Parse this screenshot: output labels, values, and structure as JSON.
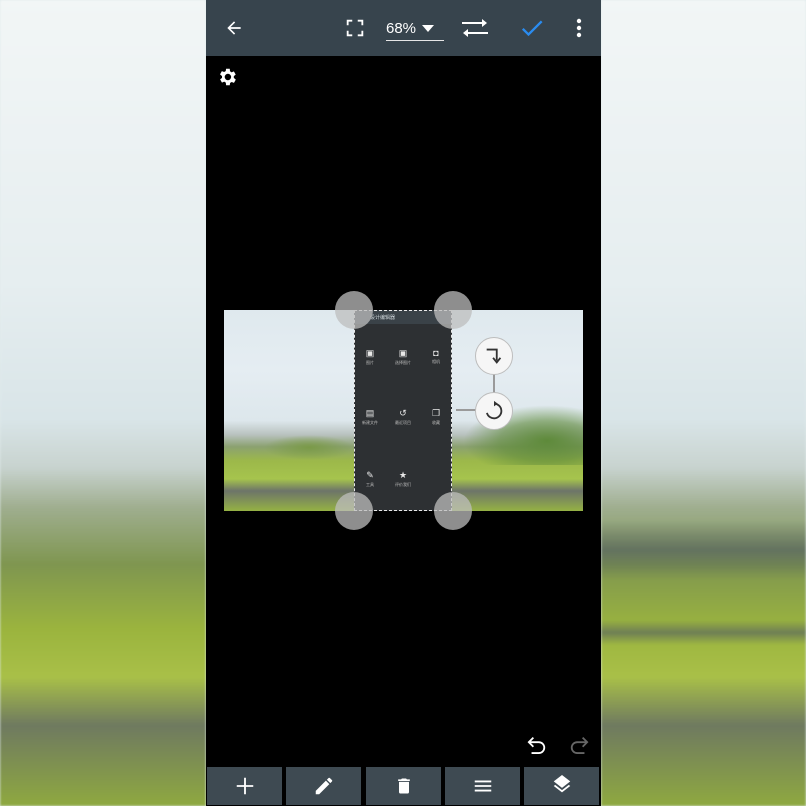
{
  "app": {
    "zoom_label": "68%",
    "accent_color": "#2a8cf0",
    "toolbar_bg": "#37444d"
  },
  "layer_preview": {
    "title": "设计编辑器",
    "items": [
      {
        "label": "图片",
        "icon": "image-icon"
      },
      {
        "label": "选择图片",
        "icon": "gallery-icon"
      },
      {
        "label": "相机",
        "icon": "camera-icon"
      },
      {
        "label": "新建文件",
        "icon": "file-icon"
      },
      {
        "label": "最近项目",
        "icon": "history-icon"
      },
      {
        "label": "收藏",
        "icon": "collection-icon"
      },
      {
        "label": "工具",
        "icon": "wrench-icon"
      },
      {
        "label": "评价我们",
        "icon": "star-icon"
      }
    ]
  },
  "bottom_tools": [
    {
      "name": "add-tool",
      "icon": "plus-icon"
    },
    {
      "name": "edit-tool",
      "icon": "pencil-icon"
    },
    {
      "name": "delete-tool",
      "icon": "trash-icon"
    },
    {
      "name": "menu-tool",
      "icon": "hamburger-icon"
    },
    {
      "name": "layers-tool",
      "icon": "layers-icon"
    }
  ]
}
